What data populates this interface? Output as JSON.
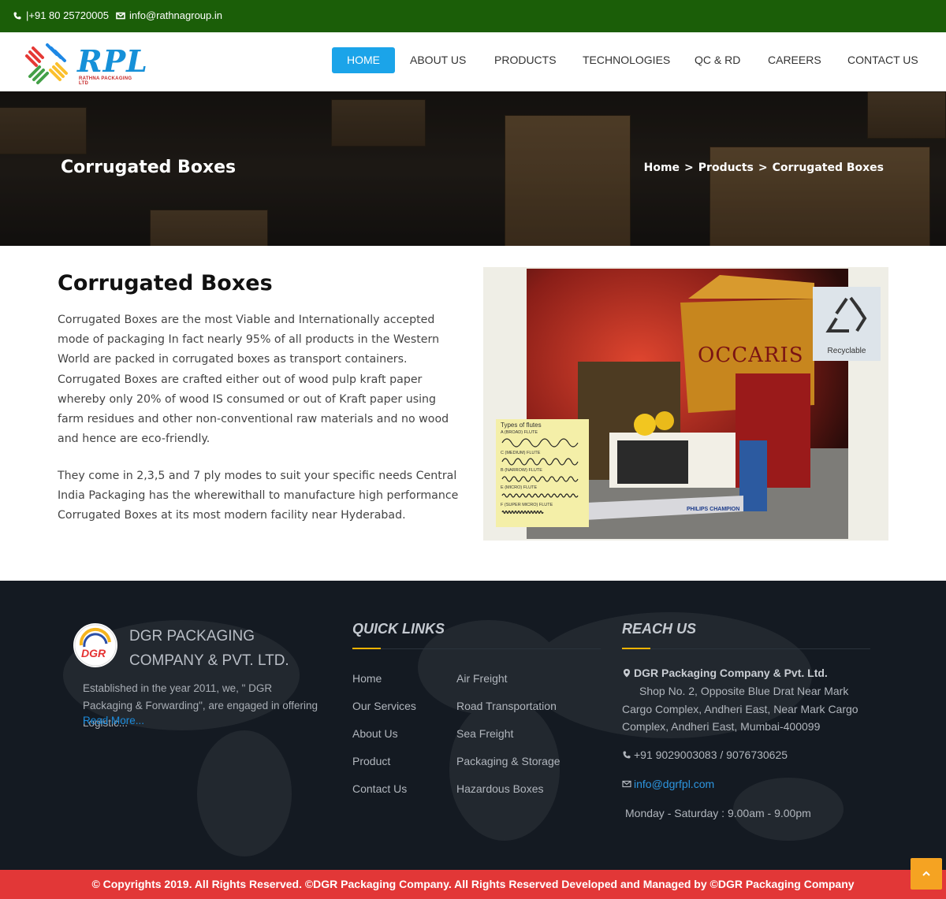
{
  "topbar": {
    "phone": "|+91 80 25720005",
    "email": "info@rathnagroup.in",
    "background": "#1b5e08"
  },
  "logo": {
    "text": "RPL",
    "subtext": "RATHNA PACKAGING LTD"
  },
  "nav": {
    "items": [
      {
        "label": "HOME",
        "active": true
      },
      {
        "label": "ABOUT US"
      },
      {
        "label": "PRODUCTS"
      },
      {
        "label": "TECHNOLOGIES"
      },
      {
        "label": "QC & RD"
      },
      {
        "label": "CAREERS"
      },
      {
        "label": "CONTACT US"
      }
    ],
    "active_color": "#1ba4e9"
  },
  "banner": {
    "title": "Corrugated Boxes",
    "breadcrumb": [
      "Home",
      "Products",
      "Corrugated Boxes"
    ],
    "separator": ">"
  },
  "content": {
    "title": "Corrugated Boxes",
    "paragraph1": "Corrugated Boxes are the most Viable and Internationally accepted mode of packaging In fact nearly 95% of all products in the Western World are packed in corrugated boxes as transport containers. Corrugated Boxes are crafted either out of wood pulp kraft paper whereby only 20% of wood IS consumed or out of Kraft paper using farm residues and other non-conventional raw materials and no wood and hence are eco-friendly.",
    "paragraph2": "They come in 2,3,5 and 7 ply modes to suit your specific needs Central India Packaging has the wherewithall to manufacture high performance Corrugated Boxes at its most modern facility near Hyderabad."
  },
  "product_image": {
    "recyclable_label": "Recyclable",
    "flutes_title": "Types of flutes",
    "flutes": [
      "A (BROAD) FLUTE",
      "C (MEDIUM) FLUTE",
      "B (NARROW) FLUTE",
      "E (MICRO) FLUTE",
      "F (SUPER MICRO) FLUTE"
    ],
    "box_brand": "OCCARIS",
    "tube_brand": "PHILIPS CHAMPION"
  },
  "footer": {
    "logo_text": "DGR",
    "company_name": "DGR PACKAGING COMPANY & PVT. LTD.",
    "about": "Established in the year 2011, we, \" DGR Packaging & Forwarding\", are engaged in offering Logistic...",
    "read_more": "Read More...",
    "quick_links_heading": "QUICK LINKS",
    "quick_links_col1": [
      "Home",
      "Our Services",
      "About Us",
      "Product",
      "Contact Us"
    ],
    "quick_links_col2": [
      "Air Freight",
      "Road Transportation",
      "Sea Freight",
      "Packaging & Storage",
      "Hazardous Boxes"
    ],
    "reach_heading": "REACH US",
    "reach_company": "DGR Packaging Company & Pvt. Ltd.",
    "reach_address": "Shop No. 2, Opposite Blue Drat Near Mark Cargo Complex, Andheri East, Near Mark Cargo Complex, Andheri East, Mumbai-400099",
    "reach_phone": "+91 9029003083 / 9076730625",
    "reach_email": "info@dgrfpl.com",
    "reach_hours": "Monday - Saturday : 9.00am - 9.00pm",
    "accent_color": "#f5b400"
  },
  "copyright": {
    "text": "© Copyrights 2019. All Rights Reserved. ©DGR Packaging Company. All Rights Reserved Developed and Managed by ©DGR Packaging Company",
    "background": "#e23737"
  },
  "to_top": {
    "icon": "arrow-up-icon",
    "color": "#f5a322"
  }
}
